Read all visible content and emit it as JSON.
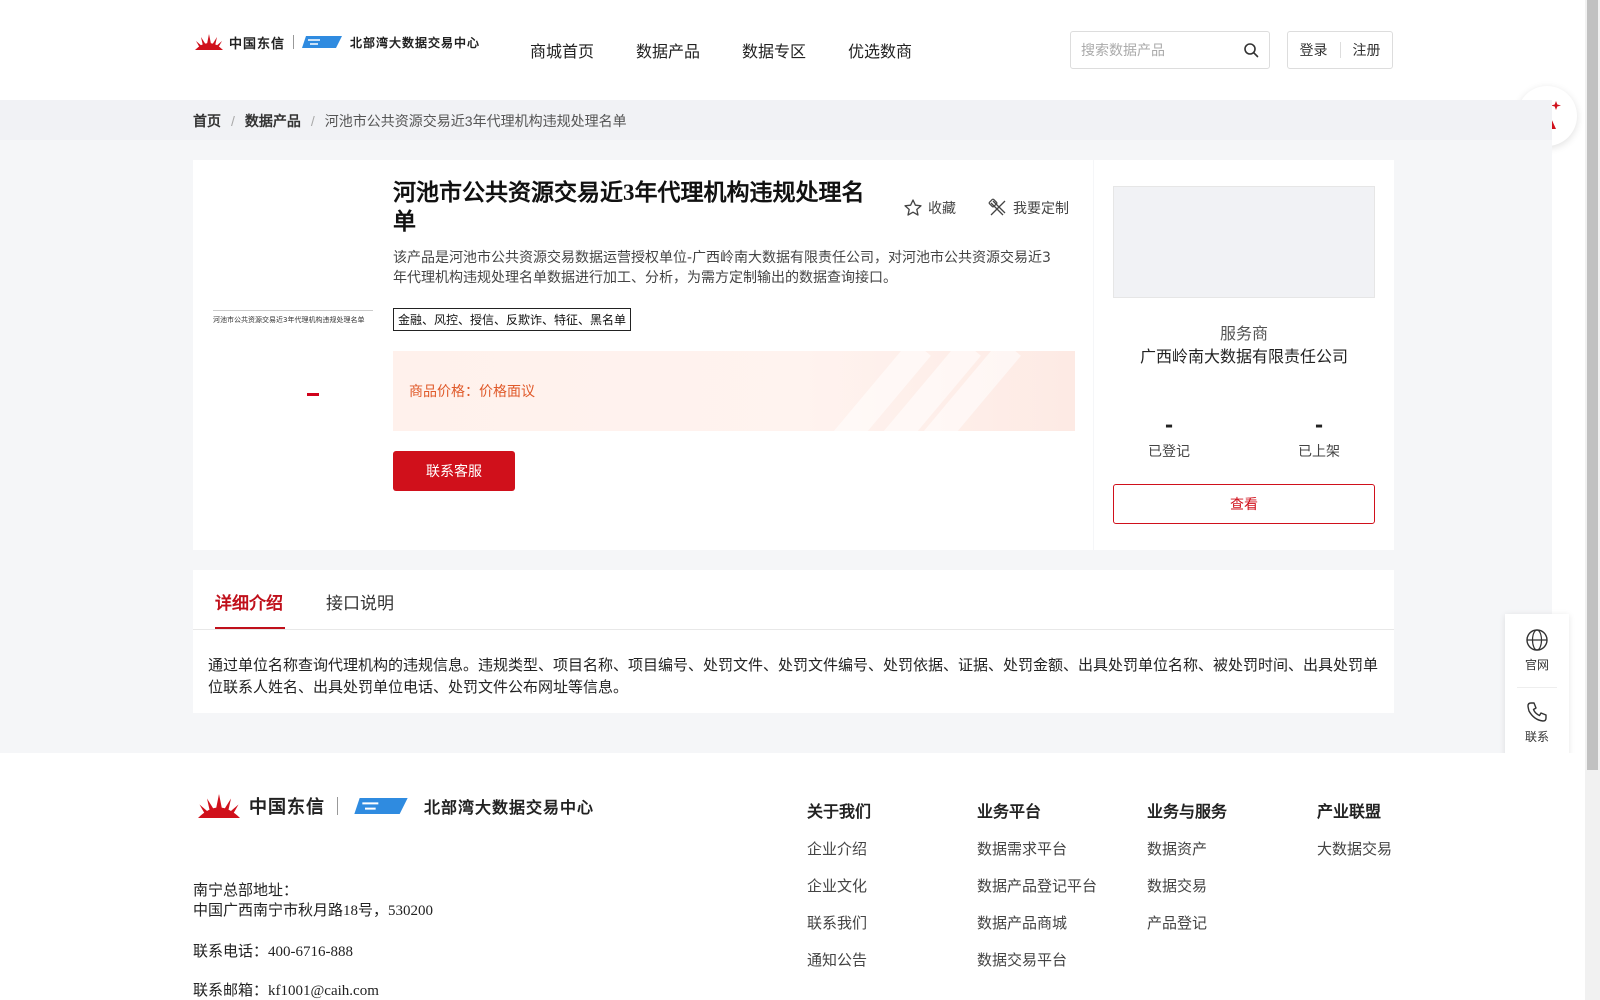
{
  "header": {
    "logo": {
      "brand_cn": "中国东信",
      "brand_en": "北部湾大数据交易中心"
    },
    "nav": [
      "商城首页",
      "数据产品",
      "数据专区",
      "优选数商"
    ],
    "search": {
      "placeholder": "搜索数据产品",
      "value": ""
    },
    "auth": {
      "login": "登录",
      "register": "注册"
    }
  },
  "breadcrumb": {
    "home": "首页",
    "category": "数据产品",
    "current": "河池市公共资源交易近3年代理机构违规处理名单"
  },
  "product": {
    "thumbnail_text": "河池市公共资源交易近3年代理机构违规处理名单",
    "title": "河池市公共资源交易近3年代理机构违规处理名单",
    "actions": {
      "favorite": "收藏",
      "customize": "我要定制"
    },
    "description": "该产品是河池市公共资源交易数据运营授权单位-广西岭南大数据有限责任公司，对河池市公共资源交易近3年代理机构违规处理名单数据进行加工、分析，为需方定制输出的数据查询接口。",
    "tags": "金融、风控、授信、反欺诈、特征、黑名单",
    "price_label": "商品价格：价格面议",
    "contact_button": "联系客服"
  },
  "provider": {
    "label": "服务商",
    "name": "广西岭南大数据有限责任公司",
    "stats": [
      {
        "value": "-",
        "label": "已登记"
      },
      {
        "value": "-",
        "label": "已上架"
      }
    ],
    "view_button": "查看"
  },
  "detail": {
    "tabs": [
      {
        "label": "详细介绍",
        "active": true
      },
      {
        "label": "接口说明",
        "active": false
      }
    ],
    "text": "通过单位名称查询代理机构的违规信息。违规类型、项目名称、项目编号、处罚文件、处罚文件编号、处罚依据、证据、处罚金额、出具处罚单位名称、被处罚时间、出具处罚单位联系人姓名、出具处罚单位电话、处罚文件公布网址等信息。"
  },
  "side_tools": [
    {
      "label": "官网",
      "icon": "globe-icon"
    },
    {
      "label": "联系",
      "icon": "phone-icon"
    }
  ],
  "footer": {
    "address_label": "南宁总部地址：",
    "address": "中国广西南宁市秋月路18号，530200",
    "phone": "联系电话：400-6716-888",
    "email": "联系邮箱：kf1001@caih.com",
    "columns": [
      {
        "title": "关于我们",
        "links": [
          "企业介绍",
          "企业文化",
          "联系我们",
          "通知公告"
        ]
      },
      {
        "title": "业务平台",
        "links": [
          "数据需求平台",
          "数据产品登记平台",
          "数据产品商城",
          "数据交易平台"
        ]
      },
      {
        "title": "业务与服务",
        "links": [
          "数据资产",
          "数据交易",
          "产品登记"
        ]
      },
      {
        "title": "产业联盟",
        "links": [
          "大数据交易"
        ]
      }
    ]
  },
  "colors": {
    "brand_red": "#d0101b",
    "price_orange": "#e05a2a",
    "logo_blue": "#2f8be0"
  }
}
